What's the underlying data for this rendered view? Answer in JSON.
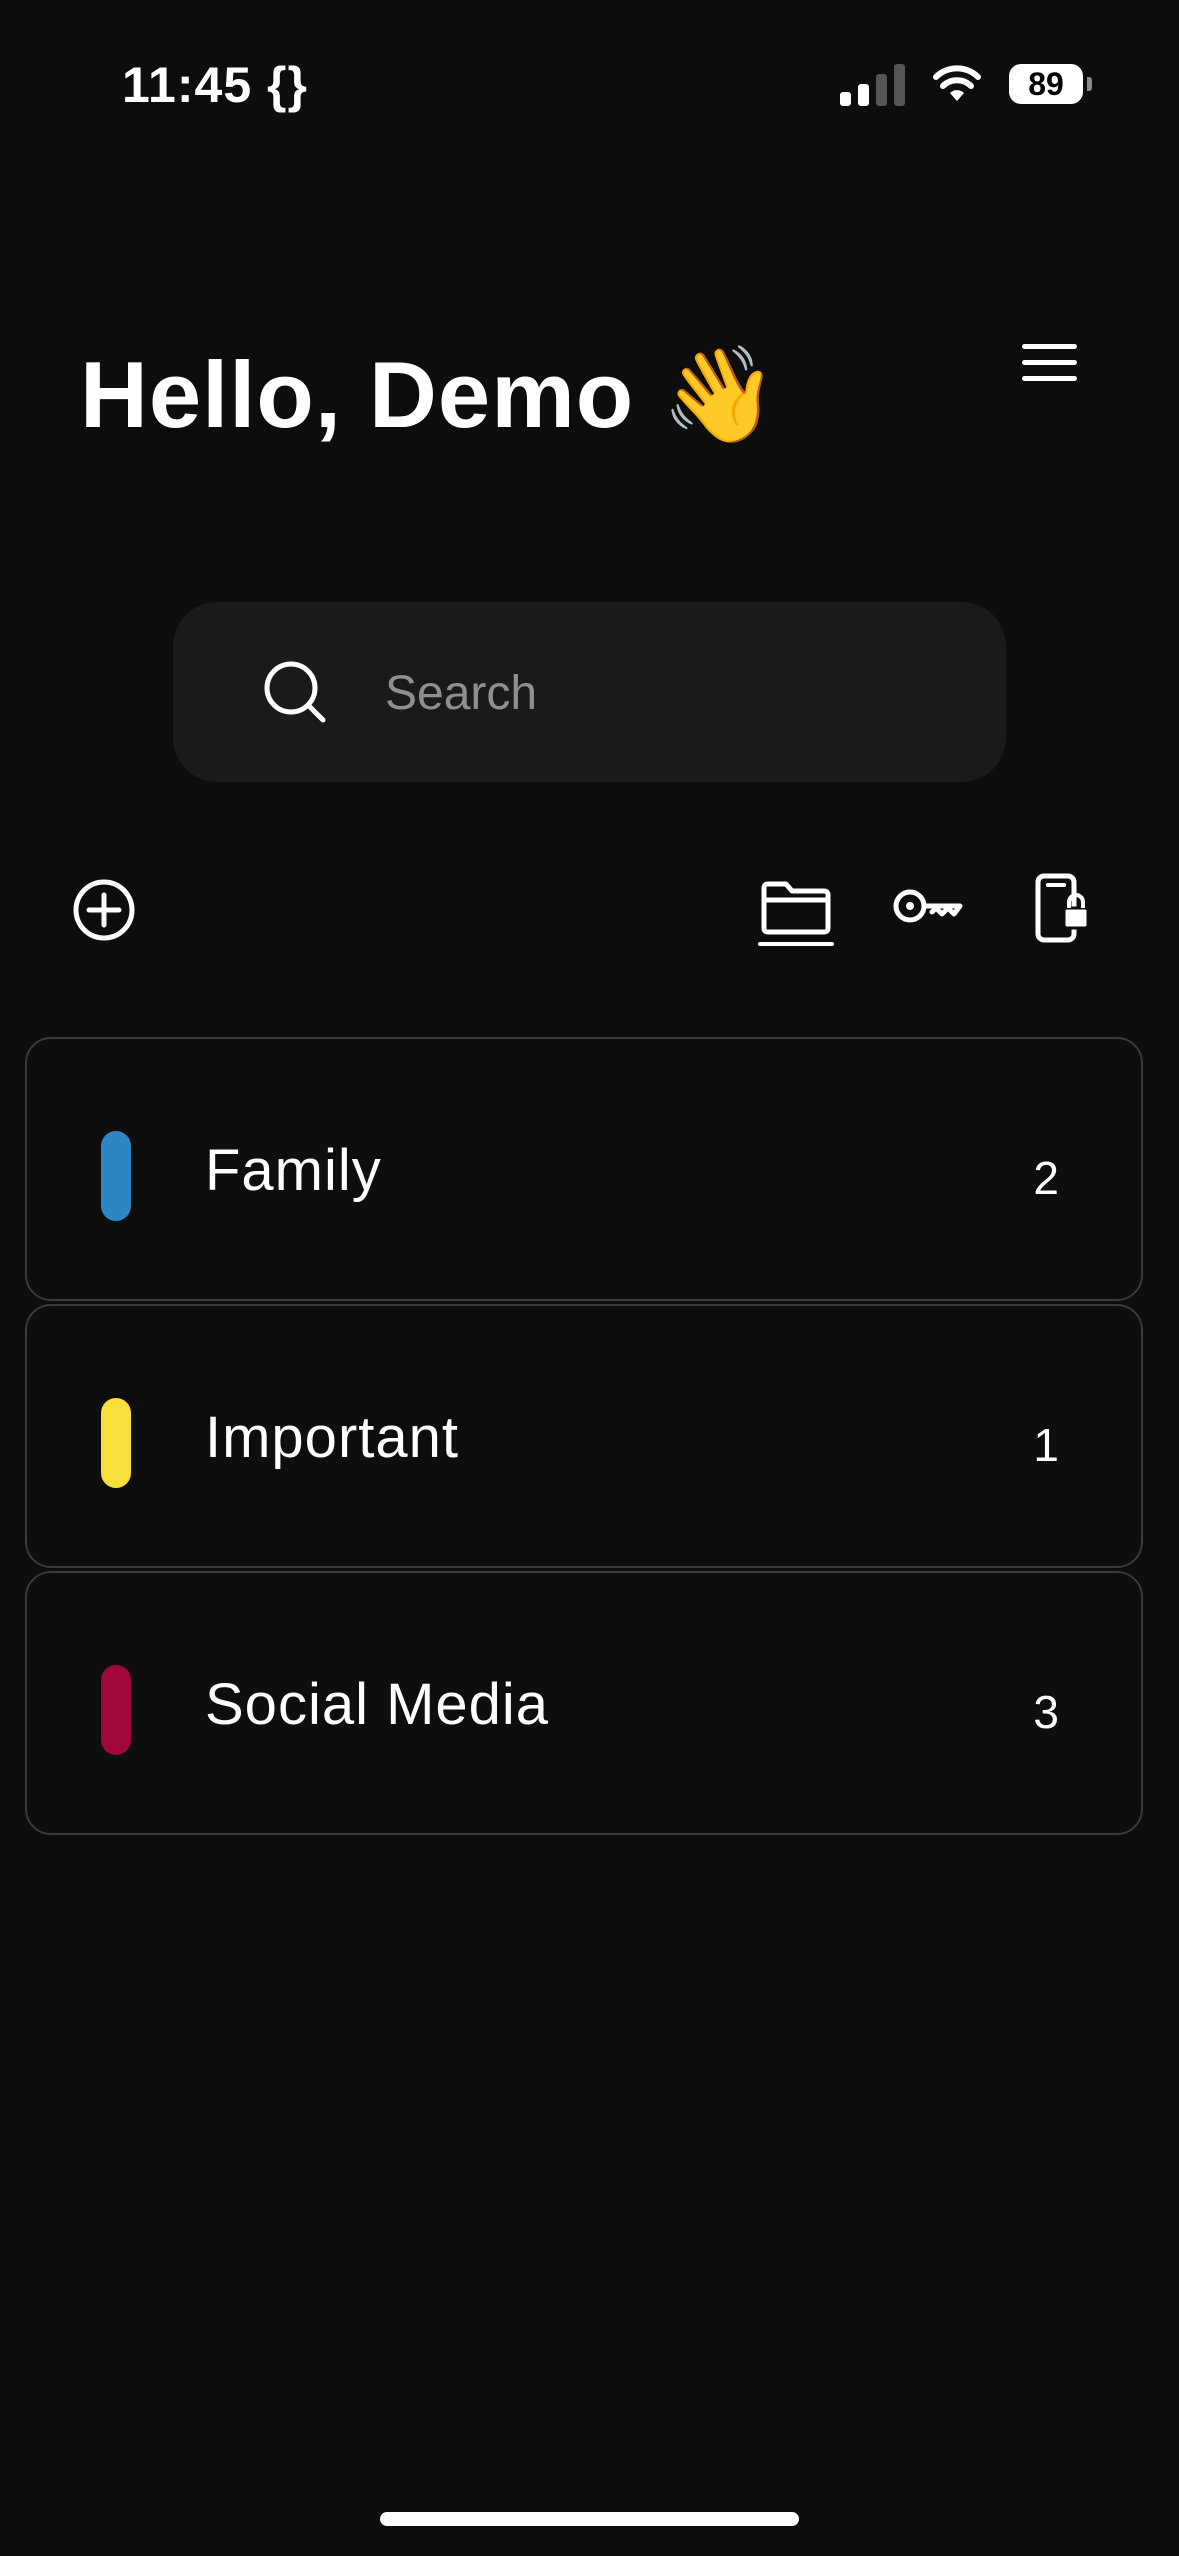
{
  "status_bar": {
    "time": "11:45 {}",
    "battery": "89",
    "icons": [
      "cellular-signal-icon",
      "wifi-icon",
      "battery-icon"
    ]
  },
  "header": {
    "greeting": "Hello, Demo",
    "wave_emoji": "👋",
    "menu_icon": "hamburger-menu-icon"
  },
  "search": {
    "placeholder": "Search",
    "value": "",
    "icon": "search-icon"
  },
  "toolbar": {
    "add_icon": "plus-circle-icon",
    "tabs": [
      {
        "icon": "folder-icon",
        "active": true
      },
      {
        "icon": "key-icon",
        "active": false
      },
      {
        "icon": "phone-lock-icon",
        "active": false
      }
    ]
  },
  "folders": [
    {
      "name": "Family",
      "count": "2",
      "color": "#2e86c1"
    },
    {
      "name": "Important",
      "count": "1",
      "color": "#f7e03c"
    },
    {
      "name": "Social Media",
      "count": "3",
      "color": "#a0073c"
    }
  ],
  "colors": {
    "background": "#0d0d0d",
    "search_background": "#1a1a1a",
    "row_border": "#3a3a3a"
  }
}
